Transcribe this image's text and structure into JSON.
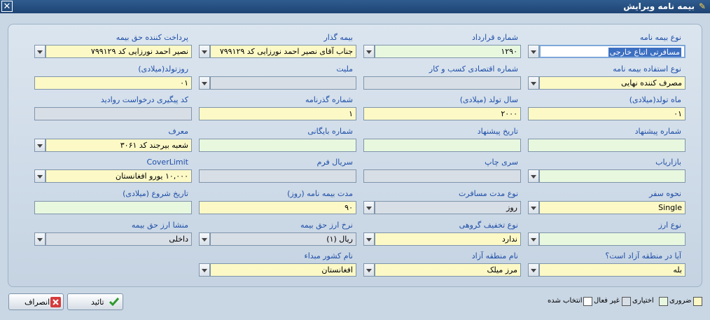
{
  "window": {
    "title": "بیمه نامه ویرایش"
  },
  "fields": {
    "policy_type": {
      "label": "نوع بیمه نامه",
      "value": "مسافرتی اتباع خارجی"
    },
    "contract_no": {
      "label": "شماره قرارداد",
      "value": "۱۲۹۰"
    },
    "insurer": {
      "label": "بیمه گذار",
      "value": "جناب آقای نصیر احمد نورزایی کد ۷۹۹۱۲۹"
    },
    "premium_payer": {
      "label": "پرداخت کننده حق بیمه",
      "value": "نصیر احمد نورزایی کد ۷۹۹۱۲۹"
    },
    "usage_type": {
      "label": "نوع استفاده بیمه نامه",
      "value": "مصرف کننده نهایی"
    },
    "econ_code": {
      "label": "شماره اقتصادی کسب و کار",
      "value": ""
    },
    "nationality": {
      "label": "ملیت",
      "value": ""
    },
    "birth_day": {
      "label": "روزتولد(میلادی)",
      "value": "۰۱"
    },
    "birth_month": {
      "label": "ماه تولد(میلادی)",
      "value": "۰۱"
    },
    "birth_year": {
      "label": "سال تولد (میلادی)",
      "value": "۲۰۰۰"
    },
    "passport_no": {
      "label": "شماره گذرنامه",
      "value": "۱"
    },
    "visa_tracking": {
      "label": "کد پیگیری درخواست روادید",
      "value": ""
    },
    "proposal_no": {
      "label": "شماره پیشنهاد",
      "value": ""
    },
    "proposal_date": {
      "label": "تاریخ پیشنهاد",
      "value": ""
    },
    "archive_no": {
      "label": "شماره بایگانی",
      "value": ""
    },
    "introducer": {
      "label": "معرف",
      "value": "شعبه بیرجند کد ۳۰۶۱"
    },
    "marketer": {
      "label": "بازاریاب",
      "value": ""
    },
    "print_series": {
      "label": "سری چاپ",
      "value": ""
    },
    "form_serial": {
      "label": "سریال فرم",
      "value": ""
    },
    "cover_limit": {
      "label": "CoverLimit",
      "value": "۱۰,۰۰۰ یورو افغانستان"
    },
    "travel_type": {
      "label": "نحوه سفر",
      "value": "Single"
    },
    "travel_duration_type": {
      "label": "نوع مدت مسافرت",
      "value": "روز"
    },
    "policy_duration": {
      "label": "مدت بیمه نامه (روز)",
      "value": "۹۰"
    },
    "start_date": {
      "label": "تاریخ شروع (میلادی)",
      "value": ""
    },
    "currency_type": {
      "label": "نوع ارز",
      "value": ""
    },
    "group_discount": {
      "label": "نوع تخفیف گروهی",
      "value": "ندارد"
    },
    "premium_rate": {
      "label": "نرخ ارز حق بیمه",
      "value": "ریال (۱)"
    },
    "premium_origin": {
      "label": "منشا ارز حق بیمه",
      "value": "داخلی"
    },
    "free_zone": {
      "label": "آیا در منطقه آزاد است؟",
      "value": "بله"
    },
    "free_zone_name": {
      "label": "نام منطقه آزاد",
      "value": "مرز میلک"
    },
    "origin_country": {
      "label": "نام کشور مبداء",
      "value": "افغانستان"
    }
  },
  "buttons": {
    "confirm": "تائید",
    "cancel": "انصراف"
  },
  "legend": {
    "required": "ضروری",
    "optional": "اختیاری",
    "inactive": "غیر فعال",
    "selected": "انتخاب شده"
  },
  "colors": {
    "required": "#fcf9c6",
    "optional": "#e8f8df",
    "inactive": "#d8dee6",
    "selected": "#ffffff",
    "label": "#1f4fa8",
    "title_bar": "#1e4474"
  }
}
